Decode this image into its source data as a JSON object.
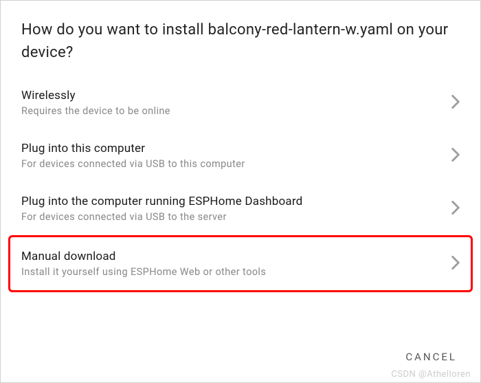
{
  "dialog": {
    "title": "How do you want to install balcony-red-lantern-w.yaml on your device?"
  },
  "options": [
    {
      "title": "Wirelessly",
      "subtitle": "Requires the device to be online",
      "highlighted": false
    },
    {
      "title": "Plug into this computer",
      "subtitle": "For devices connected via USB to this computer",
      "highlighted": false
    },
    {
      "title": "Plug into the computer running ESPHome Dashboard",
      "subtitle": "For devices connected via USB to the server",
      "highlighted": false
    },
    {
      "title": "Manual download",
      "subtitle": "Install it yourself using ESPHome Web or other tools",
      "highlighted": true
    }
  ],
  "footer": {
    "cancel_label": "CANCEL"
  },
  "watermark": "CSDN @Athelloren"
}
